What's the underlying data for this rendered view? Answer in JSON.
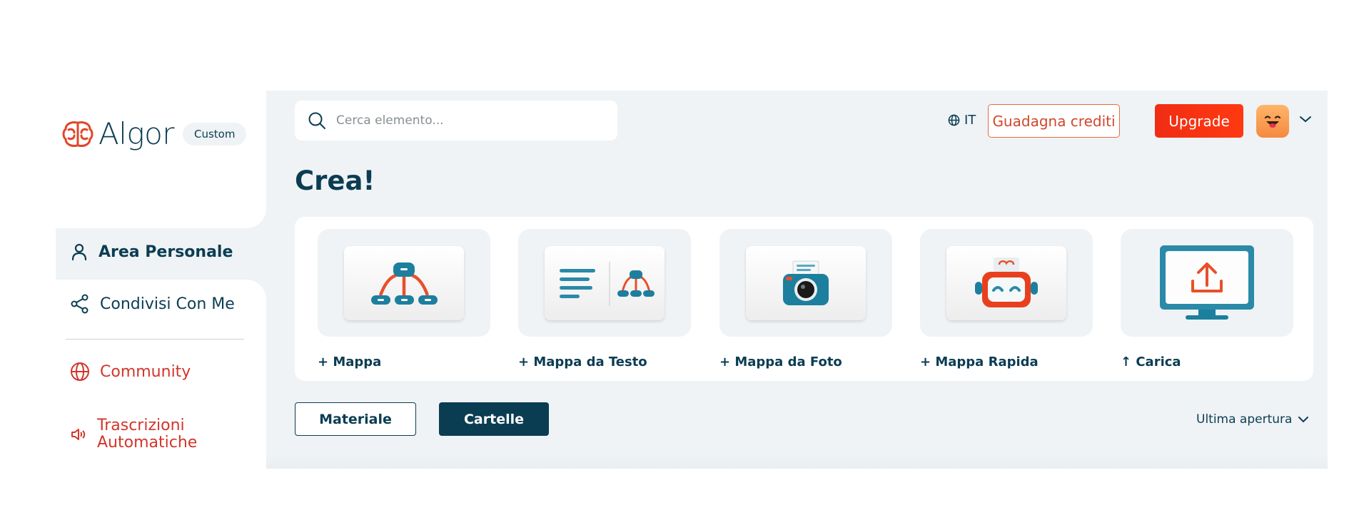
{
  "brand": {
    "name": "Algor",
    "plan": "Custom",
    "accent": "#d2362b",
    "primary": "#0b3d52"
  },
  "sidebar": {
    "items": [
      {
        "label": "Area Personale",
        "icon": "user-icon"
      },
      {
        "label": "Condivisi Con Me",
        "icon": "share-icon"
      },
      {
        "label": "Community",
        "icon": "globe-icon"
      },
      {
        "label": "Trascrizioni Automatiche",
        "icon": "speaker-icon"
      }
    ]
  },
  "header": {
    "search_placeholder": "Cerca elemento...",
    "language": "IT",
    "earn_label": "Guadagna crediti",
    "upgrade_label": "Upgrade"
  },
  "main": {
    "title": "Crea!",
    "tiles": [
      {
        "label": "+ Mappa"
      },
      {
        "label": "+ Mappa da Testo"
      },
      {
        "label": "+ Mappa da Foto"
      },
      {
        "label": "+ Mappa Rapida"
      },
      {
        "label": "↑ Carica"
      }
    ],
    "material_label": "Materiale",
    "folders_label": "Cartelle",
    "sort_label": "Ultima apertura"
  }
}
